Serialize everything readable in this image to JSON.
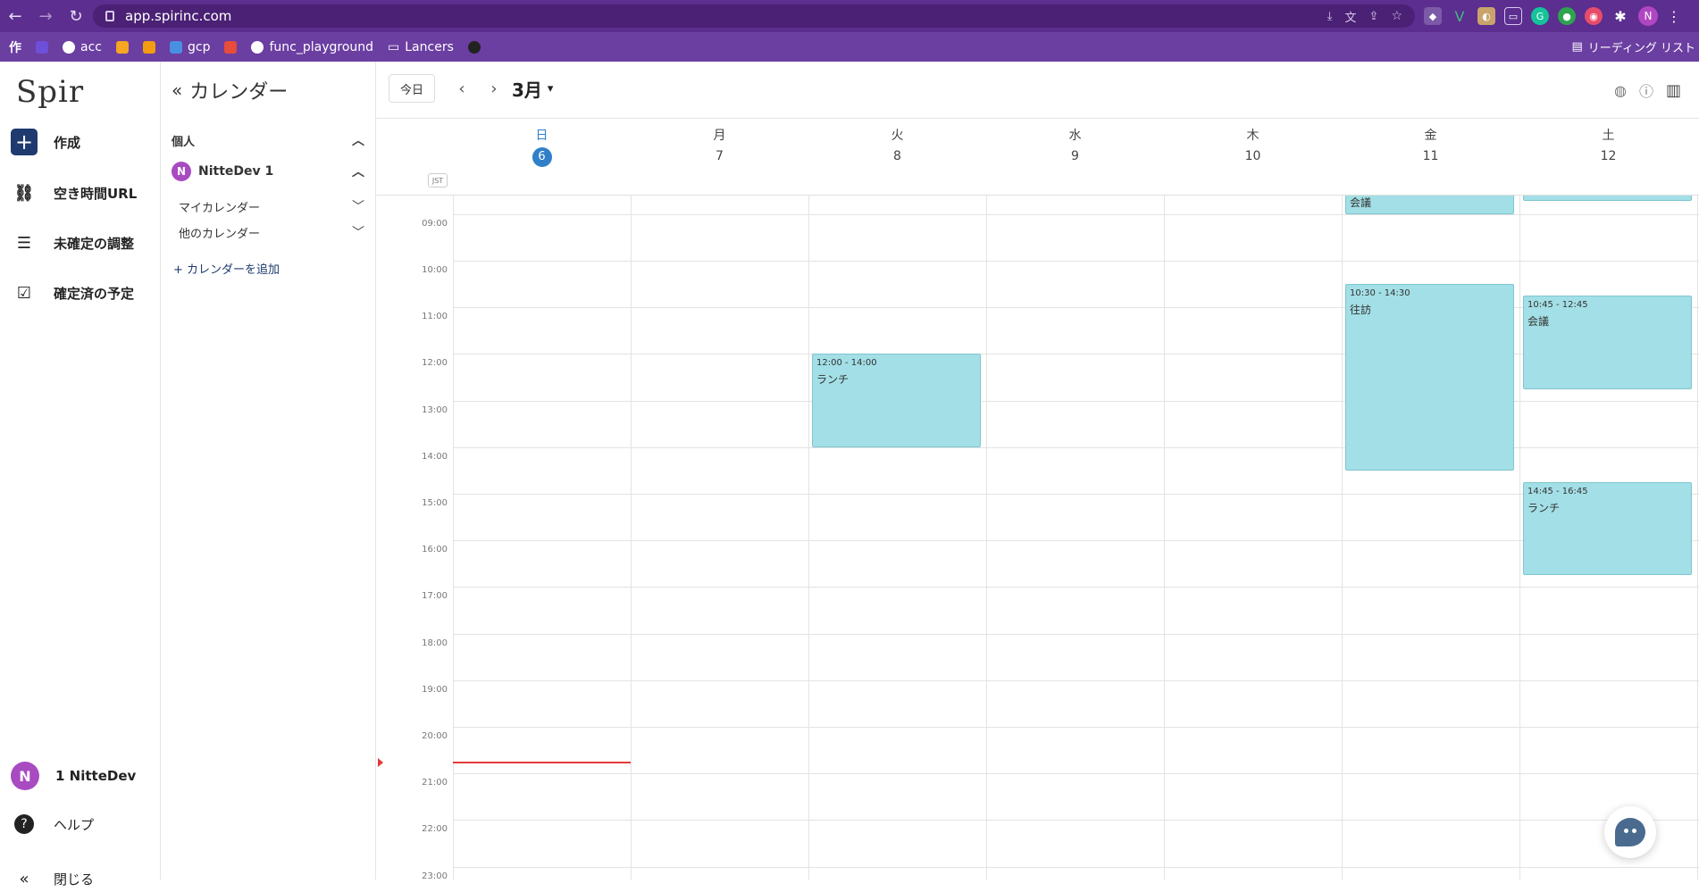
{
  "browser": {
    "url": "app.spirinc.com",
    "profile_initial": "N",
    "bookmarks": [
      "作",
      "acc",
      "gcp",
      "func_playground",
      "Lancers"
    ],
    "reading_list": "リーディング リスト"
  },
  "leftnav": {
    "logo": "Spir",
    "items": [
      {
        "label": "作成",
        "icon": "plus-icon"
      },
      {
        "label": "空き時間URL",
        "icon": "link-icon"
      },
      {
        "label": "未確定の調整",
        "icon": "pending-list-icon"
      },
      {
        "label": "確定済の予定",
        "icon": "check-calendar-icon"
      }
    ],
    "user": {
      "initial": "N",
      "name": "1 NitteDev"
    },
    "help": "ヘルプ",
    "close": "閉じる"
  },
  "calpanel": {
    "title": "カレンダー",
    "section": "個人",
    "account": {
      "initial": "N",
      "name": "NitteDev 1"
    },
    "groups": [
      "マイカレンダー",
      "他のカレンダー"
    ],
    "add_calendar": "+ カレンダーを追加"
  },
  "toolbar": {
    "today": "今日",
    "month": "3月"
  },
  "days": [
    {
      "weekday": "日",
      "date": "6",
      "today": true
    },
    {
      "weekday": "月",
      "date": "7"
    },
    {
      "weekday": "火",
      "date": "8"
    },
    {
      "weekday": "水",
      "date": "9"
    },
    {
      "weekday": "木",
      "date": "10"
    },
    {
      "weekday": "金",
      "date": "11"
    },
    {
      "weekday": "土",
      "date": "12"
    }
  ],
  "timezone": "JST",
  "hours": [
    "09:00",
    "10:00",
    "11:00",
    "12:00",
    "13:00",
    "14:00",
    "15:00",
    "16:00",
    "17:00",
    "18:00",
    "19:00",
    "20:00",
    "21:00",
    "22:00",
    "23:00"
  ],
  "events": [
    {
      "day": 5,
      "start": 8.2,
      "end": 9.0,
      "time": "",
      "title": "会議"
    },
    {
      "day": 6,
      "start": 8.2,
      "end": 8.7,
      "time": "",
      "title": ""
    },
    {
      "day": 2,
      "start": 12.0,
      "end": 14.0,
      "time": "12:00 - 14:00",
      "title": "ランチ"
    },
    {
      "day": 5,
      "start": 10.5,
      "end": 14.5,
      "time": "10:30 - 14:30",
      "title": "往訪"
    },
    {
      "day": 6,
      "start": 10.75,
      "end": 12.75,
      "time": "10:45 - 12:45",
      "title": "会議"
    },
    {
      "day": 6,
      "start": 14.75,
      "end": 16.75,
      "time": "14:45 - 16:45",
      "title": "ランチ"
    }
  ],
  "now": {
    "day": 0,
    "hour": 20.75
  }
}
